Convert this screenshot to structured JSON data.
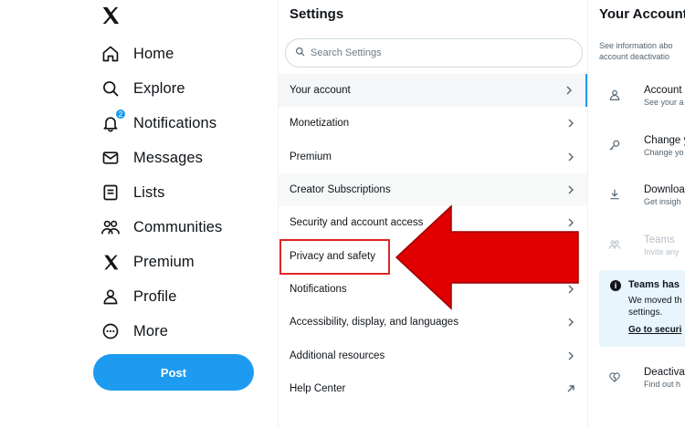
{
  "nav": {
    "items": [
      {
        "label": "Home",
        "icon": "home-icon"
      },
      {
        "label": "Explore",
        "icon": "search-icon"
      },
      {
        "label": "Notifications",
        "icon": "bell-icon",
        "badge": "2"
      },
      {
        "label": "Messages",
        "icon": "envelope-icon"
      },
      {
        "label": "Lists",
        "icon": "list-icon"
      },
      {
        "label": "Communities",
        "icon": "people-icon"
      },
      {
        "label": "Premium",
        "icon": "x-logo-icon"
      },
      {
        "label": "Profile",
        "icon": "person-icon"
      },
      {
        "label": "More",
        "icon": "more-circle-icon"
      }
    ],
    "post_label": "Post"
  },
  "settings": {
    "title": "Settings",
    "search_placeholder": "Search Settings",
    "menu": [
      {
        "label": "Your account",
        "chevron": "chevron-right-icon"
      },
      {
        "label": "Monetization",
        "chevron": "chevron-right-icon"
      },
      {
        "label": "Premium",
        "chevron": "chevron-right-icon"
      },
      {
        "label": "Creator Subscriptions",
        "chevron": "chevron-right-icon"
      },
      {
        "label": "Security and account access",
        "chevron": "chevron-right-icon"
      },
      {
        "label": "Privacy and safety",
        "chevron": "chevron-right-icon"
      },
      {
        "label": "Notifications",
        "chevron": "chevron-right-icon"
      },
      {
        "label": "Accessibility, display, and languages",
        "chevron": "chevron-right-icon"
      },
      {
        "label": "Additional resources",
        "chevron": "chevron-right-icon"
      },
      {
        "label": "Help Center",
        "chevron": "external-link-icon"
      }
    ]
  },
  "account": {
    "title": "Your Account",
    "description_line1": "See information abo",
    "description_line2": "account deactivatio",
    "items": [
      {
        "title": "Account",
        "subtitle": "See your a",
        "icon": "person-icon"
      },
      {
        "title": "Change y",
        "subtitle": "Change yo",
        "icon": "key-icon"
      },
      {
        "title": "Downloa",
        "subtitle": "Get insigh",
        "icon": "download-icon"
      },
      {
        "title": "Teams",
        "subtitle": "Invite any",
        "icon": "people-icon"
      },
      {
        "title": "Deactiva",
        "subtitle": "Find out h",
        "icon": "broken-heart-icon"
      }
    ],
    "notice": {
      "title": "Teams has",
      "body_line1": "We moved th",
      "body_line2": "settings.",
      "link": "Go to securi"
    }
  },
  "colors": {
    "accent": "#1d9bf0",
    "annotation_red": "#e02626"
  }
}
